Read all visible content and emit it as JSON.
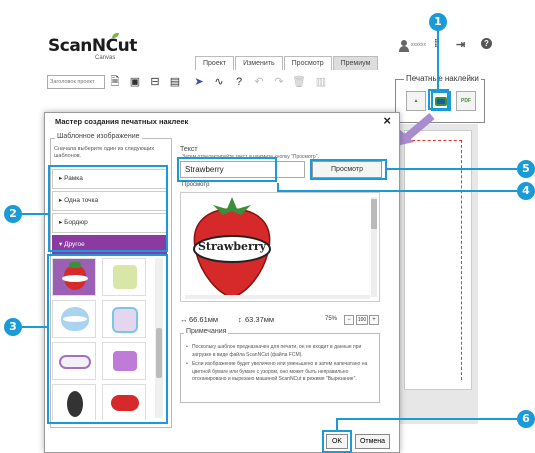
{
  "app": {
    "logo_text": "ScanNCut",
    "logo_sub": "Canvas",
    "user_name": "xxxxxx"
  },
  "tabs": [
    {
      "label": "Проект"
    },
    {
      "label": "Изменить"
    },
    {
      "label": "Просмотр"
    },
    {
      "label": "Премиум",
      "active": true
    }
  ],
  "toolbar": {
    "project_title_placeholder": "Заголовок проект"
  },
  "print_panel": {
    "title": "Печатные наклейки",
    "buttons": [
      "image-sticker",
      "text-sticker",
      "pdf-export"
    ]
  },
  "dialog": {
    "title": "Мастер создания печатных наклеек",
    "left_group": {
      "title": "Шаблонное изображение",
      "instruction": "Сначала выберите один из следующих шаблонов.",
      "categories": [
        {
          "label": "▸ Рамка"
        },
        {
          "label": "▸ Одна точка"
        },
        {
          "label": "▸ Бордюр"
        },
        {
          "label": "▾ Другое",
          "active": true
        }
      ]
    },
    "text_group": {
      "title": "Текст",
      "instruction": "Затем отредактируйте текст и нажмите кнопку \"Просмотр\".",
      "value": "Strawberry",
      "preview_button": "Просмотр"
    },
    "preview": {
      "title": "Просмотр",
      "label_text": "Strawberry"
    },
    "dims": {
      "width": "66.61мм",
      "height": "63.37мм",
      "zoom": "75%",
      "zoom_100": "100"
    },
    "notes": {
      "title": "Примечания",
      "items": [
        "Поскольку шаблон предназначен для печати, он не входит в данные при загрузке в виде файла ScanNCut (файла FCM).",
        "Если изображение будет увеличено или уменьшено и затем напечатано на цветной бумаге или бумаге с узором, оно может быть неправильно отсканировано и вырезано машиной ScanNCut в режиме \"Вырезание\"."
      ]
    },
    "ok_label": "OK",
    "cancel_label": "Отмена"
  },
  "callouts": [
    "1",
    "2",
    "3",
    "4",
    "5",
    "6"
  ],
  "colors": {
    "accent": "#1a9ad6",
    "category_active": "#8a3aa0",
    "strawberry": "#d62a2a"
  }
}
